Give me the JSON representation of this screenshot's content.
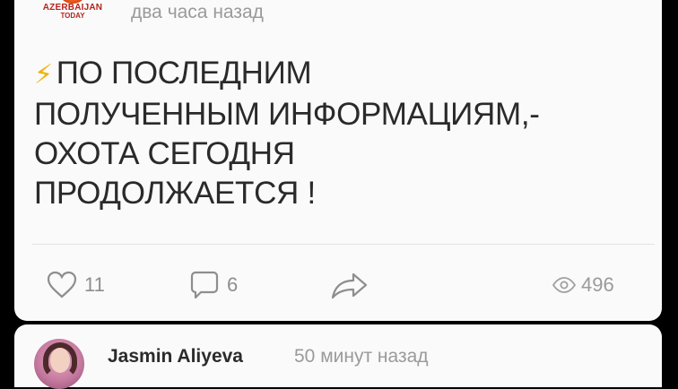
{
  "post": {
    "source_line1": "AZERBAIJAN",
    "source_line2": "TODAY",
    "time": "два часа назад",
    "text_lines": [
      "ПО ПОСЛЕДНИМ",
      "ПОЛУЧЕННЫМ ИНФОРМАЦИЯМ,-",
      "ОХОТА СЕГОДНЯ",
      "ПРОДОЛЖАЕТСЯ !"
    ],
    "likes": "11",
    "comments": "6",
    "views": "496"
  },
  "comment": {
    "author": "Jasmin Aliyeva",
    "time": "50 минут назад"
  },
  "colors": {
    "background": "#000000",
    "card": "#fafafa",
    "brand_red": "#b5241e",
    "bolt": "#f2b200",
    "muted_text": "#9a9a9a"
  },
  "icons": [
    "heart-icon",
    "comment-icon",
    "share-icon",
    "eye-icon",
    "lightning-icon"
  ]
}
